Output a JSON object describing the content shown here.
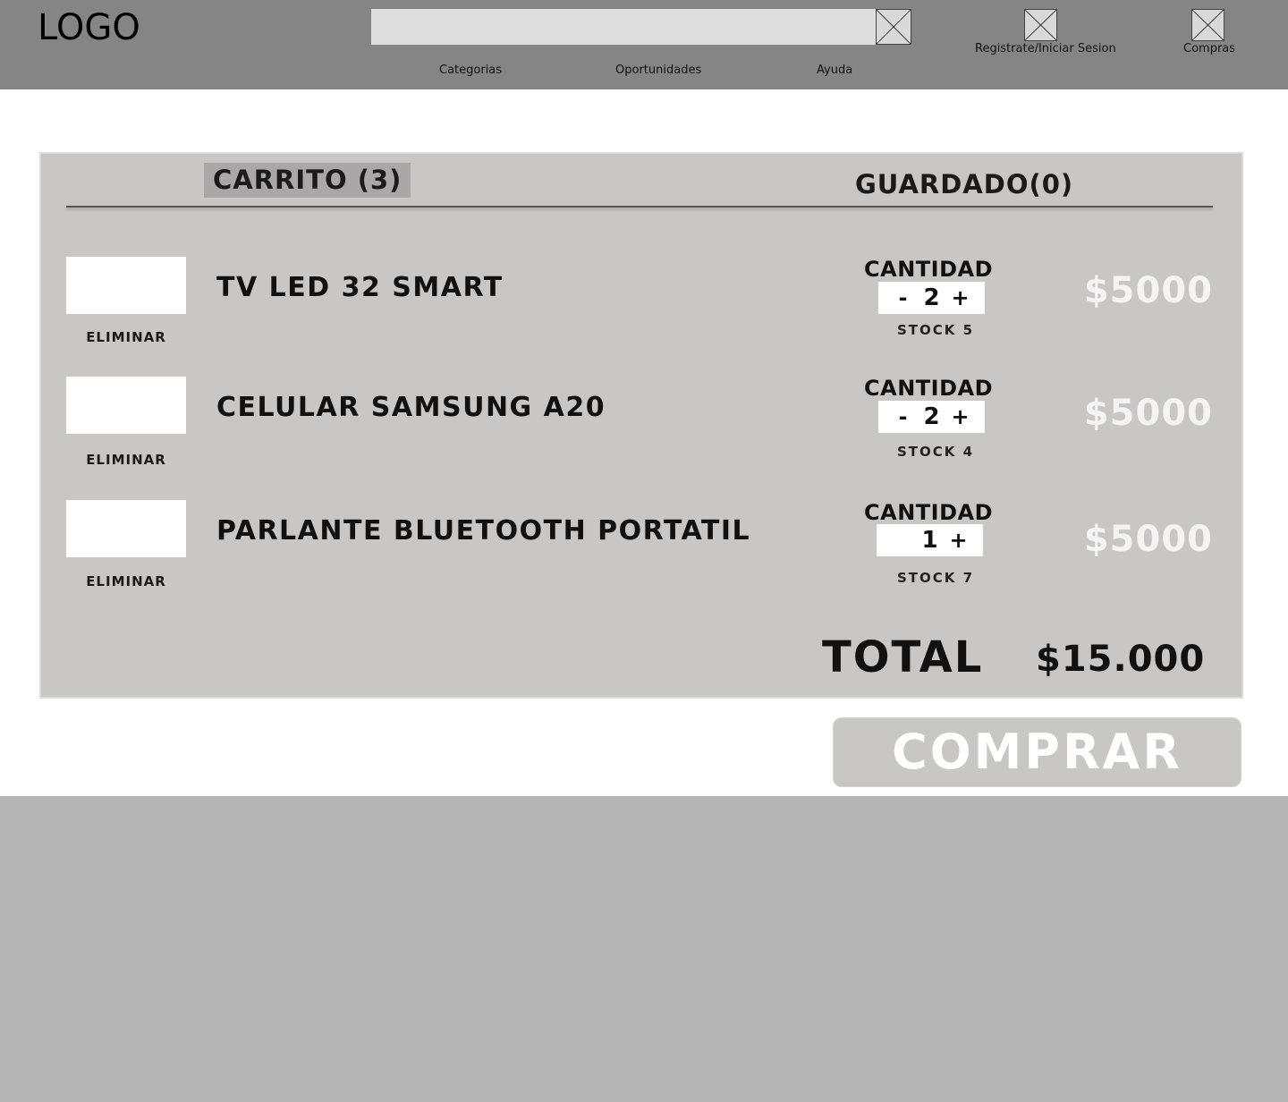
{
  "header": {
    "logo": "LOGO",
    "search": {
      "placeholder": "",
      "value": ""
    },
    "search_icon": "broken-image-placeholder-icon",
    "login": {
      "icon": "broken-image-placeholder-icon",
      "label": "Registrate/Iniciar Sesion"
    },
    "purchases": {
      "icon": "broken-image-placeholder-icon",
      "label": "Compras"
    },
    "nav": [
      "Categorias",
      "Oportunidades",
      "Ayuda"
    ]
  },
  "cart": {
    "tabs": {
      "cart": "CARRITO (3)",
      "saved": "GUARDADO(0)"
    },
    "items": [
      {
        "name": "TV LED 32 SMART",
        "remove": "ELIMINAR",
        "qty_label": "CANTIDAD",
        "minus": "-",
        "qty": "2",
        "plus": "+",
        "stock": "STOCK 5",
        "price": "$5000"
      },
      {
        "name": "CELULAR SAMSUNG A20",
        "remove": "ELIMINAR",
        "qty_label": "CANTIDAD",
        "minus": "-",
        "qty": "2",
        "plus": "+",
        "stock": "STOCK 4",
        "price": "$5000"
      },
      {
        "name": "PARLANTE BLUETOOTH PORTATIL",
        "remove": "ELIMINAR",
        "qty_label": "CANTIDAD",
        "minus": "",
        "qty": "1",
        "plus": "+",
        "stock": "STOCK 7",
        "price": "$5000"
      }
    ],
    "total_label": "TOTAL",
    "total_value": "$15.000",
    "buy_button": "COMPRAR"
  },
  "colors": {
    "header_bg": "#858585",
    "panel_bg": "#c9c6c6",
    "page_bg": "#ffffff",
    "footer_bg": "#b5b5b5",
    "price_text": "#f4f4f4"
  }
}
